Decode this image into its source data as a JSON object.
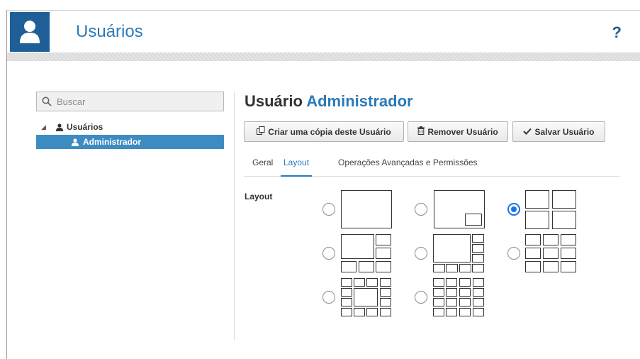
{
  "header": {
    "title": "Usuários",
    "icon": "user-icon",
    "help_label": "?",
    "accent_color": "#1f5f97"
  },
  "sidebar": {
    "search": {
      "placeholder": "Buscar",
      "value": ""
    },
    "tree": {
      "root_label": "Usuários",
      "root_toggle": "◢",
      "children": [
        {
          "label": "Administrador",
          "selected": true
        }
      ]
    }
  },
  "main": {
    "heading_prefix": "Usuário",
    "heading_name": "Administrador",
    "buttons": {
      "copy_label": "Criar uma cópia deste Usuário",
      "remove_label": "Remover Usuário",
      "save_label": "Salvar Usuário"
    },
    "tabs": [
      {
        "label": "Geral",
        "active": false
      },
      {
        "label": "Layout",
        "active": true
      },
      {
        "label": "Operações Avançadas e Permissões",
        "active": false
      }
    ],
    "layout_label": "Layout",
    "layout_options": [
      {
        "id": "1x1",
        "selected": false
      },
      {
        "id": "1-pip",
        "selected": false
      },
      {
        "id": "2x2",
        "selected": true
      },
      {
        "id": "1+5",
        "selected": false
      },
      {
        "id": "1+7",
        "selected": false
      },
      {
        "id": "3x3",
        "selected": false
      },
      {
        "id": "1+12",
        "selected": false
      },
      {
        "id": "4x4",
        "selected": false
      }
    ]
  }
}
